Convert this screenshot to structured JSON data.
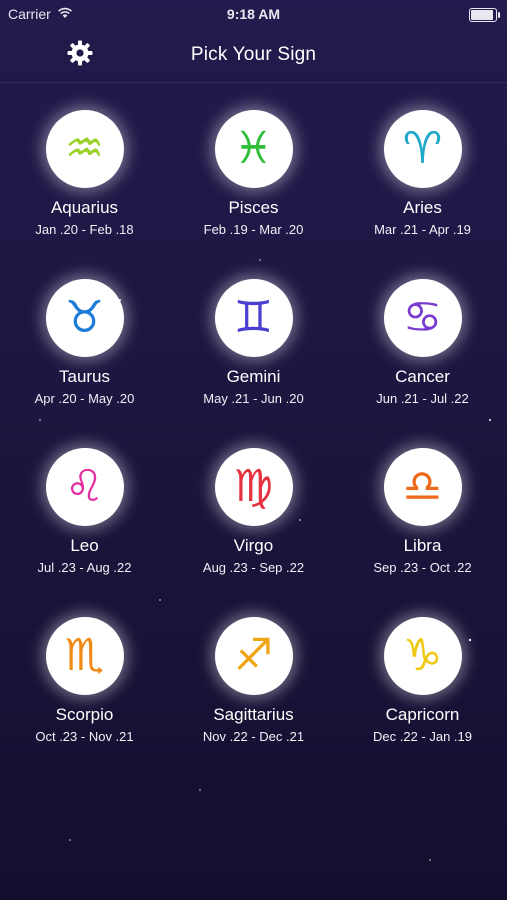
{
  "status_bar": {
    "carrier": "Carrier",
    "time": "9:18 AM"
  },
  "nav": {
    "title": "Pick Your Sign",
    "settings_icon": "gear-icon"
  },
  "signs": [
    {
      "name": "Aquarius",
      "dates": "Jan .20 - Feb .18",
      "glyph": "♒",
      "color": "#9bd126",
      "icon": "aquarius-icon"
    },
    {
      "name": "Pisces",
      "dates": "Feb .19 - Mar .20",
      "glyph": "♓",
      "color": "#2fbf3a",
      "icon": "pisces-icon"
    },
    {
      "name": "Aries",
      "dates": "Mar .21 - Apr .19",
      "glyph": "♈",
      "color": "#22a9c9",
      "icon": "aries-icon"
    },
    {
      "name": "Taurus",
      "dates": "Apr .20 - May .20",
      "glyph": "♉",
      "color": "#1e7bd6",
      "icon": "taurus-icon"
    },
    {
      "name": "Gemini",
      "dates": "May .21 - Jun .20",
      "glyph": "♊",
      "color": "#4a3fd0",
      "icon": "gemini-icon"
    },
    {
      "name": "Cancer",
      "dates": "Jun .21 - Jul .22",
      "glyph": "♋",
      "color": "#7a3ad0",
      "icon": "cancer-icon"
    },
    {
      "name": "Leo",
      "dates": "Jul .23 - Aug .22",
      "glyph": "♌",
      "color": "#e32fa2",
      "icon": "leo-icon"
    },
    {
      "name": "Virgo",
      "dates": "Aug .23 - Sep .22",
      "glyph": "♍",
      "color": "#e5323f",
      "icon": "virgo-icon"
    },
    {
      "name": "Libra",
      "dates": "Sep .23 - Oct .22",
      "glyph": "♎",
      "color": "#ee6a1a",
      "icon": "libra-icon"
    },
    {
      "name": "Scorpio",
      "dates": "Oct .23 - Nov .21",
      "glyph": "♏",
      "color": "#f08a16",
      "icon": "scorpio-icon"
    },
    {
      "name": "Sagittarius",
      "dates": "Nov .22 - Dec .21",
      "glyph": "♐",
      "color": "#f0a514",
      "icon": "sagittarius-icon"
    },
    {
      "name": "Capricorn",
      "dates": "Dec .22 - Jan .19",
      "glyph": "♑",
      "color": "#f0c814",
      "icon": "capricorn-icon"
    }
  ]
}
